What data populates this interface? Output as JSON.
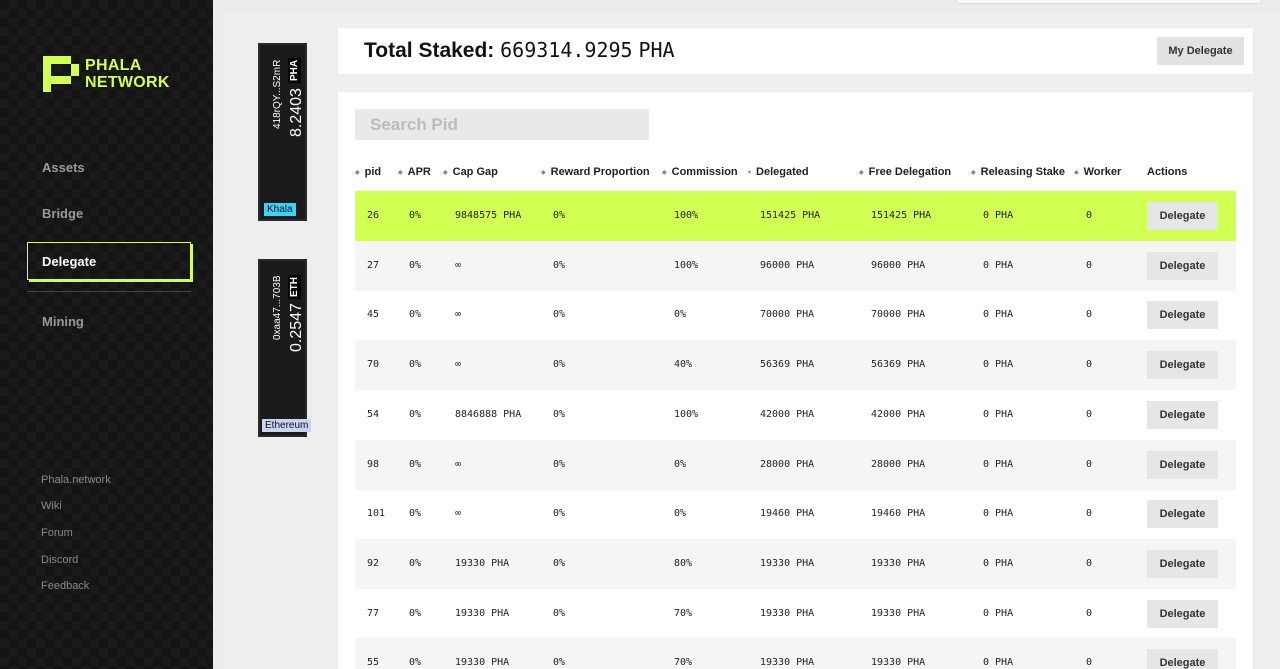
{
  "sidebar": {
    "logo_line1": "PHALA",
    "logo_line2": "NETWORK",
    "nav": [
      {
        "label": "Assets"
      },
      {
        "label": "Bridge"
      },
      {
        "label": "Delegate"
      },
      {
        "label": "Mining"
      }
    ],
    "footer_links": [
      "Phala.network",
      "Wiki",
      "Forum",
      "Discord",
      "Feedback"
    ]
  },
  "accounts": [
    {
      "address": "418rQY...S2mR",
      "token": "PHA",
      "balance": "8.2403",
      "network": "Khala",
      "network_color": "#3ad3ff"
    },
    {
      "address": "0xaa47...703B",
      "token": "ETH",
      "balance": "0.2547",
      "network": "Ethereum",
      "network_color": "#c9d4f2"
    }
  ],
  "header": {
    "total_staked_label": "Total Staked:",
    "total_staked_value": "669314.9295",
    "total_staked_unit": "PHA",
    "my_delegate_label": "My Delegate"
  },
  "search": {
    "placeholder": "Search Pid",
    "value": ""
  },
  "table": {
    "columns": [
      "pid",
      "APR",
      "Cap Gap",
      "Reward Proportion",
      "Commission",
      "Delegated",
      "Free Delegation",
      "Releasing Stake",
      "Worker",
      "Actions"
    ],
    "action_label": "Delegate",
    "rows": [
      {
        "pid": "26",
        "apr": "0%",
        "cap_gap": "9848575 PHA",
        "reward": "0%",
        "commission": "100%",
        "delegated": "151425 PHA",
        "free": "151425 PHA",
        "releasing": "0 PHA",
        "worker": "0"
      },
      {
        "pid": "27",
        "apr": "0%",
        "cap_gap": "∞",
        "reward": "0%",
        "commission": "100%",
        "delegated": "96000 PHA",
        "free": "96000 PHA",
        "releasing": "0 PHA",
        "worker": "0"
      },
      {
        "pid": "45",
        "apr": "0%",
        "cap_gap": "∞",
        "reward": "0%",
        "commission": "0%",
        "delegated": "70000 PHA",
        "free": "70000 PHA",
        "releasing": "0 PHA",
        "worker": "0"
      },
      {
        "pid": "70",
        "apr": "0%",
        "cap_gap": "∞",
        "reward": "0%",
        "commission": "40%",
        "delegated": "56369 PHA",
        "free": "56369 PHA",
        "releasing": "0 PHA",
        "worker": "0"
      },
      {
        "pid": "54",
        "apr": "0%",
        "cap_gap": "8846888 PHA",
        "reward": "0%",
        "commission": "100%",
        "delegated": "42000 PHA",
        "free": "42000 PHA",
        "releasing": "0 PHA",
        "worker": "0"
      },
      {
        "pid": "98",
        "apr": "0%",
        "cap_gap": "∞",
        "reward": "0%",
        "commission": "0%",
        "delegated": "28000 PHA",
        "free": "28000 PHA",
        "releasing": "0 PHA",
        "worker": "0"
      },
      {
        "pid": "101",
        "apr": "0%",
        "cap_gap": "∞",
        "reward": "0%",
        "commission": "0%",
        "delegated": "19460 PHA",
        "free": "19460 PHA",
        "releasing": "0 PHA",
        "worker": "0"
      },
      {
        "pid": "92",
        "apr": "0%",
        "cap_gap": "19330 PHA",
        "reward": "0%",
        "commission": "80%",
        "delegated": "19330 PHA",
        "free": "19330 PHA",
        "releasing": "0 PHA",
        "worker": "0"
      },
      {
        "pid": "77",
        "apr": "0%",
        "cap_gap": "19330 PHA",
        "reward": "0%",
        "commission": "70%",
        "delegated": "19330 PHA",
        "free": "19330 PHA",
        "releasing": "0 PHA",
        "worker": "0"
      },
      {
        "pid": "55",
        "apr": "0%",
        "cap_gap": "19330 PHA",
        "reward": "0%",
        "commission": "70%",
        "delegated": "19330 PHA",
        "free": "19330 PHA",
        "releasing": "0 PHA",
        "worker": "0"
      }
    ]
  },
  "colors": {
    "accent": "#d1ff52",
    "sidebar_bg": "#141414",
    "highlight_row": "#d1ff52"
  }
}
